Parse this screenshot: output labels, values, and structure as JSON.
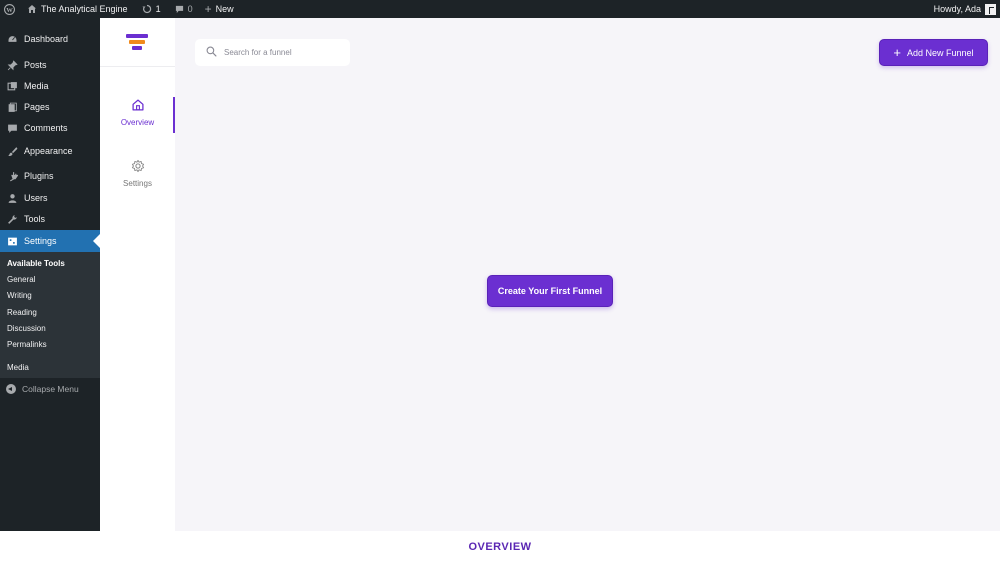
{
  "adminbar": {
    "site_name": "The Analytical Engine",
    "updates_count": "1",
    "comments_count": "0",
    "new_label": "New",
    "howdy": "Howdy, Ada"
  },
  "sidebar": {
    "items": [
      {
        "label": "Dashboard",
        "icon": "dashboard-icon"
      },
      {
        "label": "Posts",
        "icon": "pin-icon"
      },
      {
        "label": "Media",
        "icon": "media-icon"
      },
      {
        "label": "Pages",
        "icon": "pages-icon"
      },
      {
        "label": "Comments",
        "icon": "comment-icon"
      },
      {
        "label": "Appearance",
        "icon": "brush-icon"
      },
      {
        "label": "Plugins",
        "icon": "plugin-icon"
      },
      {
        "label": "Users",
        "icon": "user-icon"
      },
      {
        "label": "Tools",
        "icon": "wrench-icon"
      },
      {
        "label": "Settings",
        "icon": "settings-icon"
      }
    ],
    "submenu": [
      "Available Tools",
      "General",
      "Writing",
      "Reading",
      "Discussion",
      "Permalinks",
      "Media"
    ],
    "collapse_label": "Collapse Menu"
  },
  "plugin_nav": {
    "overview_label": "Overview",
    "settings_label": "Settings"
  },
  "main": {
    "search_placeholder": "Search for a funnel",
    "add_button_label": "Add New Funnel",
    "create_button_label": "Create Your First Funnel"
  },
  "caption": "OVERVIEW",
  "colors": {
    "accent": "#6b2fd1",
    "logo_orange": "#f08a1c",
    "admin_dark": "#1d2327",
    "active_blue": "#2271b1"
  }
}
